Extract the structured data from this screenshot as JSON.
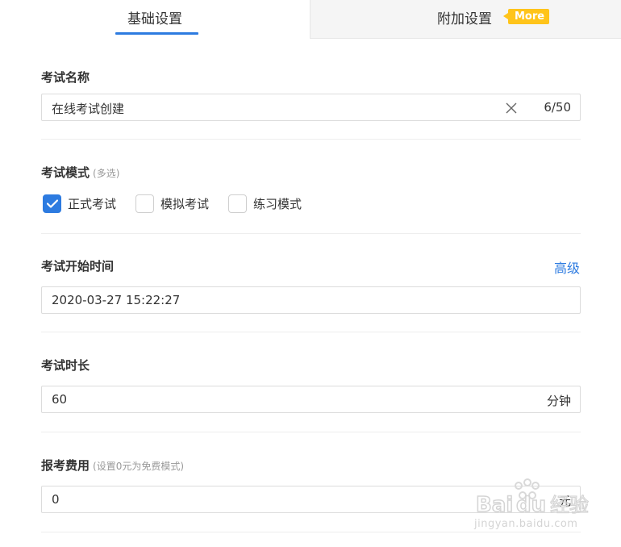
{
  "tabs": {
    "basic_label": "基础设置",
    "extra_label": "附加设置",
    "more_badge": "More"
  },
  "exam_name": {
    "label": "考试名称",
    "value": "在线考试创建",
    "counter": "6/50",
    "clear_icon": "close-icon"
  },
  "exam_mode": {
    "label": "考试模式",
    "note": "(多选)",
    "options": [
      {
        "label": "正式考试",
        "checked": true
      },
      {
        "label": "模拟考试",
        "checked": false
      },
      {
        "label": "练习模式",
        "checked": false
      }
    ]
  },
  "start_time": {
    "label": "考试开始时间",
    "advanced_link": "高级",
    "value": "2020-03-27 15:22:27"
  },
  "duration": {
    "label": "考试时长",
    "value": "60",
    "unit": "分钟"
  },
  "fee": {
    "label": "报考费用",
    "note": "(设置0元为免费模式)",
    "value": "0",
    "unit": "元"
  },
  "watermark": {
    "logo_text": "Baidu经验",
    "url_text": "jingyan.baidu.com"
  },
  "colors": {
    "accent": "#2d7be0",
    "badge": "#ffc41a"
  }
}
